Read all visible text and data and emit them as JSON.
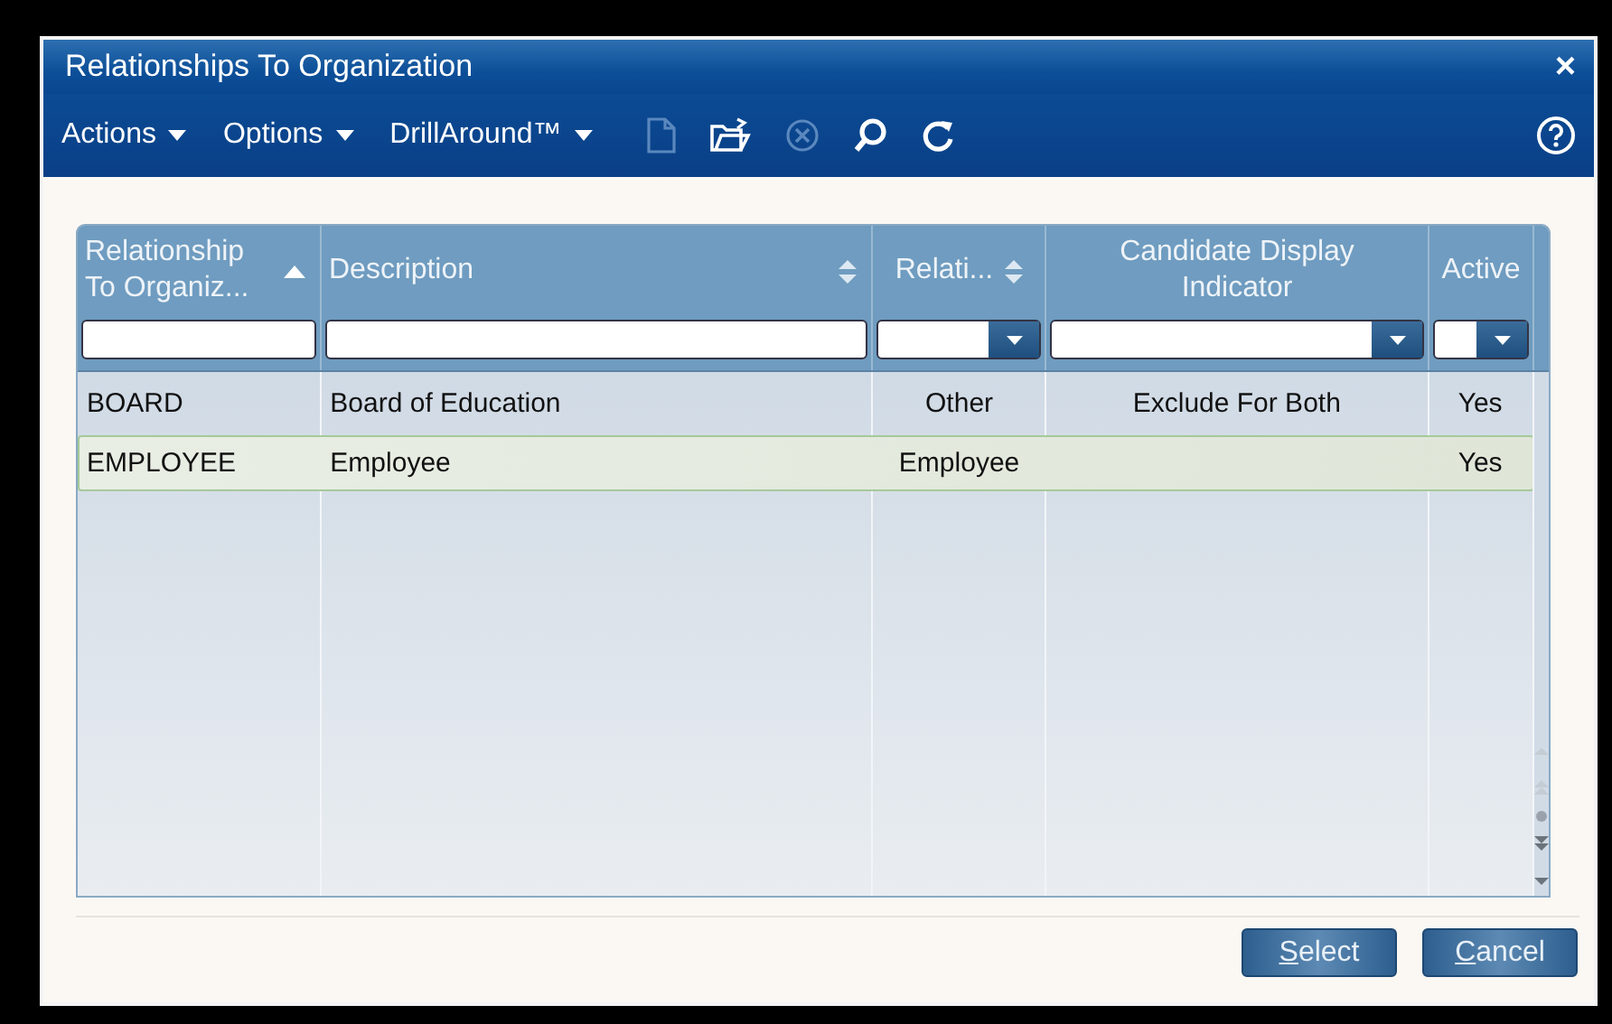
{
  "window": {
    "title": "Relationships To Organization",
    "close": "×"
  },
  "toolbar": {
    "menus": [
      {
        "label": "Actions"
      },
      {
        "label": "Options"
      },
      {
        "label": "DrillAround™"
      }
    ],
    "tools": [
      {
        "kind": "new",
        "disabled": true
      },
      {
        "kind": "open",
        "disabled": false
      },
      {
        "kind": "cancel",
        "disabled": true
      },
      {
        "kind": "search",
        "disabled": false
      },
      {
        "kind": "refresh",
        "disabled": false
      }
    ]
  },
  "table": {
    "columns": [
      {
        "label": "Relationship To Organiz...",
        "sorted": true,
        "sortable": true,
        "dropdown_filter": false,
        "centered": false
      },
      {
        "label": "Description",
        "sorted": false,
        "sortable": true,
        "dropdown_filter": false,
        "centered": false
      },
      {
        "label": "Relati...",
        "sorted": false,
        "sortable": true,
        "dropdown_filter": true,
        "centered": true
      },
      {
        "label": "Candidate Display Indicator",
        "sortable": false,
        "dropdown_filter": true,
        "centered": true
      },
      {
        "label": "Active",
        "sortable": false,
        "dropdown_filter": true,
        "centered": true
      }
    ],
    "rows": [
      {
        "cells": [
          "BOARD",
          "Board of Education",
          "Other",
          "Exclude For Both",
          "Yes"
        ],
        "selected": false
      },
      {
        "cells": [
          "EMPLOYEE",
          "Employee",
          "Employee",
          "",
          "Yes"
        ],
        "selected": true
      }
    ]
  },
  "buttons": [
    {
      "label": "Select"
    },
    {
      "label": "Cancel"
    }
  ]
}
